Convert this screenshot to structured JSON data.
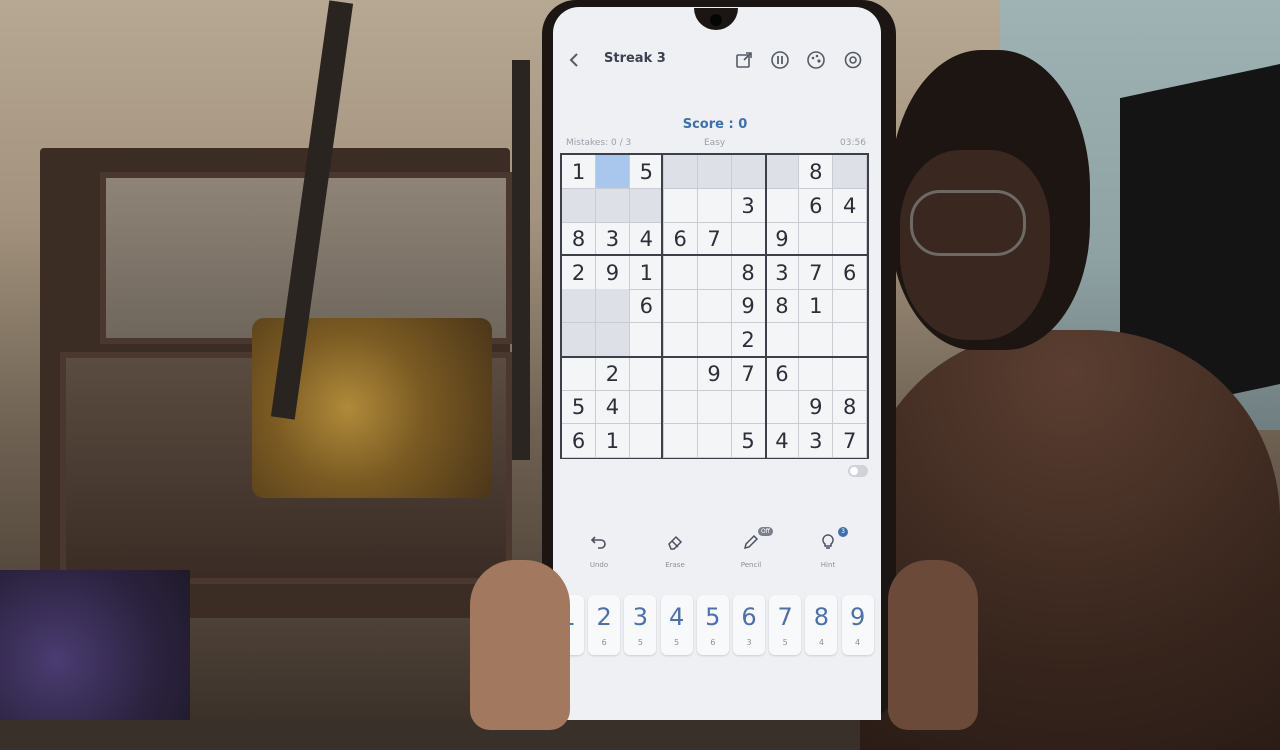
{
  "header": {
    "title": "Streak 3",
    "icons": [
      "back-icon",
      "share-icon",
      "pause-icon",
      "palette-icon",
      "settings-icon"
    ]
  },
  "status": {
    "score": "Score : 0",
    "mistakes": "Mistakes: 0 / 3",
    "difficulty": "Easy",
    "timer": "03:56"
  },
  "board": {
    "rows": [
      [
        "1",
        "",
        "5",
        "",
        "",
        "",
        "",
        "8",
        ""
      ],
      [
        "",
        "",
        "",
        "",
        "",
        "3",
        "",
        "6",
        "4"
      ],
      [
        "8",
        "3",
        "4",
        "6",
        "7",
        "",
        "9",
        "",
        ""
      ],
      [
        "2",
        "9",
        "1",
        "",
        "",
        "8",
        "3",
        "7",
        "6"
      ],
      [
        "",
        "",
        "6",
        "",
        "",
        "9",
        "8",
        "1",
        ""
      ],
      [
        "",
        "",
        "",
        "",
        "",
        "2",
        "",
        "",
        ""
      ],
      [
        "",
        "2",
        "",
        "",
        "9",
        "7",
        "6",
        "",
        ""
      ],
      [
        "5",
        "4",
        "",
        "",
        "",
        "",
        "",
        "9",
        "8"
      ],
      [
        "6",
        "1",
        "",
        "",
        "",
        "5",
        "4",
        "3",
        "7"
      ]
    ],
    "selected_cell": [
      0,
      1
    ]
  },
  "tools": [
    {
      "label": "Undo",
      "icon": "undo-icon"
    },
    {
      "label": "Erase",
      "icon": "eraser-icon"
    },
    {
      "label": "Pencil",
      "icon": "pencil-icon",
      "badge": "Off"
    },
    {
      "label": "Hint",
      "icon": "lightbulb-icon",
      "badge": "3"
    }
  ],
  "number_pad": [
    {
      "digit": "1",
      "remaining": "5"
    },
    {
      "digit": "2",
      "remaining": "6"
    },
    {
      "digit": "3",
      "remaining": "5"
    },
    {
      "digit": "4",
      "remaining": "5"
    },
    {
      "digit": "5",
      "remaining": "6"
    },
    {
      "digit": "6",
      "remaining": "3"
    },
    {
      "digit": "7",
      "remaining": "5"
    },
    {
      "digit": "8",
      "remaining": "4"
    },
    {
      "digit": "9",
      "remaining": "4"
    }
  ],
  "colors": {
    "accent": "#3d6fb5",
    "selected_cell": "#a9c6ec",
    "shaded_cell": "#dde1e7"
  }
}
